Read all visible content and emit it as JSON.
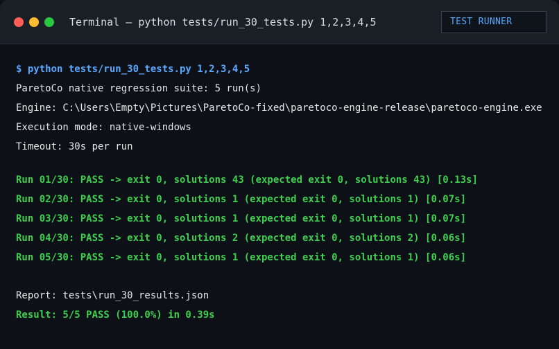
{
  "window": {
    "title": "Terminal — python tests/run_30_tests.py 1,2,3,4,5",
    "badge": "TEST RUNNER"
  },
  "terminal": {
    "command": "$ python tests/run_30_tests.py 1,2,3,4,5",
    "header": [
      "ParetoCo native regression suite: 5 run(s)",
      "Engine: C:\\Users\\Empty\\Pictures\\ParetoCo-fixed\\paretoco-engine-release\\paretoco-engine.exe",
      "Execution mode: native-windows",
      "Timeout: 30s per run"
    ],
    "runs": [
      "Run 01/30: PASS -> exit 0, solutions 43 (expected exit 0, solutions 43) [0.13s]",
      "Run 02/30: PASS -> exit 0, solutions 1 (expected exit 0, solutions 1) [0.07s]",
      "Run 03/30: PASS -> exit 0, solutions 1 (expected exit 0, solutions 1) [0.07s]",
      "Run 04/30: PASS -> exit 0, solutions 2 (expected exit 0, solutions 2) [0.06s]",
      "Run 05/30: PASS -> exit 0, solutions 1 (expected exit 0, solutions 1) [0.06s]"
    ],
    "report": "Report: tests\\run_30_results.json",
    "result": "Result: 5/5 PASS (100.0%) in 0.39s"
  },
  "colors": {
    "background": "#0d1117",
    "titlebar": "#1a1f26",
    "command": "#5aa8ff",
    "pass": "#3fcf4f",
    "text": "#e6e6e6",
    "close": "#ff5f57",
    "minimize": "#febc2e",
    "maximize": "#28c840"
  }
}
